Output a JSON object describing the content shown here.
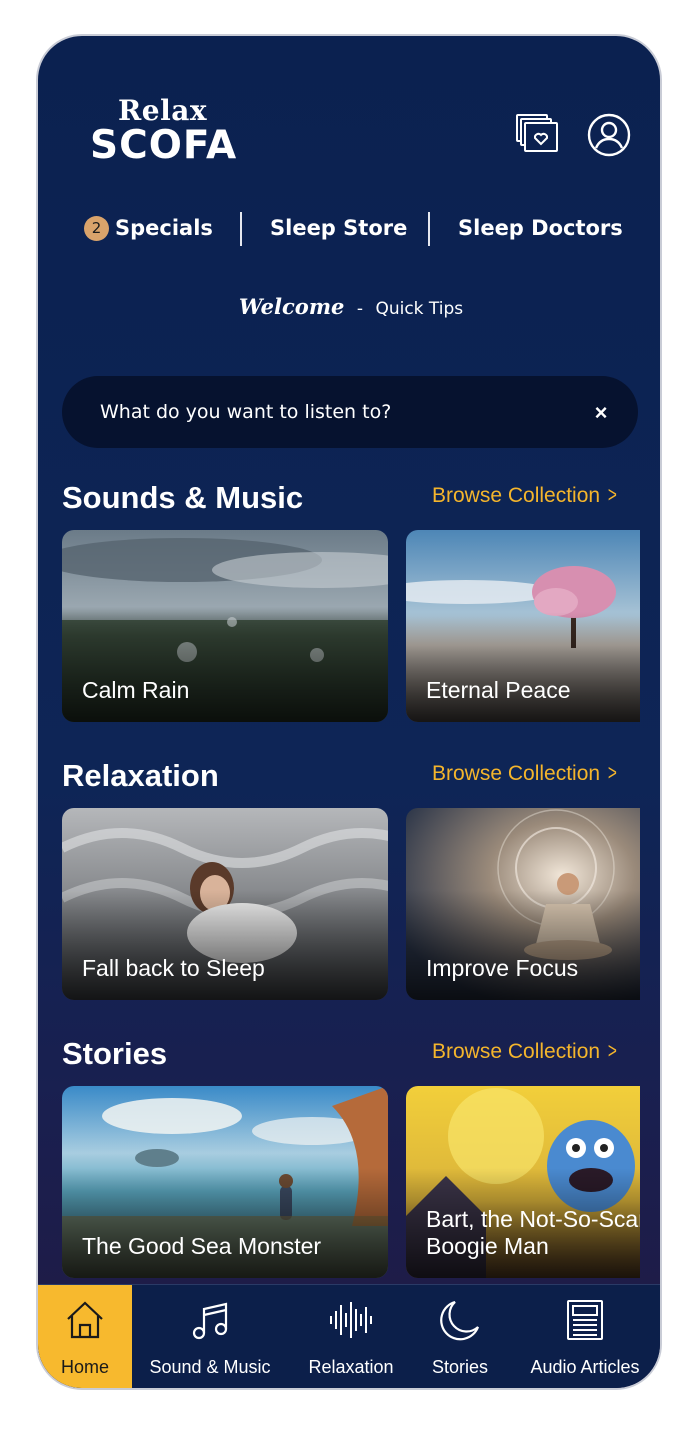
{
  "header": {
    "logo_top": "Relax",
    "logo_bottom": "SCOFA",
    "favorites_icon": "favorites-icon",
    "profile_icon": "user-profile-icon"
  },
  "top_nav": {
    "specials_badge": "2",
    "specials": "Specials",
    "sleep_store": "Sleep Store",
    "sleep_doctors": "Sleep Doctors"
  },
  "welcome": {
    "title": "Welcome",
    "separator": "-",
    "tips": "Quick Tips"
  },
  "search": {
    "placeholder": "What do you want to listen to?",
    "clear": "×"
  },
  "sections": [
    {
      "title": "Sounds & Music",
      "browse": "Browse Collection",
      "cards": [
        "Calm Rain",
        "Eternal Peace"
      ]
    },
    {
      "title": "Relaxation",
      "browse": "Browse Collection",
      "cards": [
        "Fall back to Sleep",
        "Improve Focus"
      ]
    },
    {
      "title": "Stories",
      "browse": "Browse Collection",
      "cards": [
        "The Good Sea Monster",
        "Bart, the Not-So-Scary Boogie Man"
      ]
    }
  ],
  "tabbar": {
    "items": [
      {
        "label": "Home",
        "icon": "home-icon",
        "active": true
      },
      {
        "label": "Sound & Music",
        "icon": "music-note-icon",
        "active": false
      },
      {
        "label": "Relaxation",
        "icon": "sound-wave-icon",
        "active": false
      },
      {
        "label": "Stories",
        "icon": "moon-icon",
        "active": false
      },
      {
        "label": "Audio Articles",
        "icon": "article-icon",
        "active": false
      }
    ]
  },
  "colors": {
    "background": "#0b2150",
    "accent": "#f4b52c",
    "active_tab": "#f7b92e",
    "badge": "#d9a36b"
  }
}
